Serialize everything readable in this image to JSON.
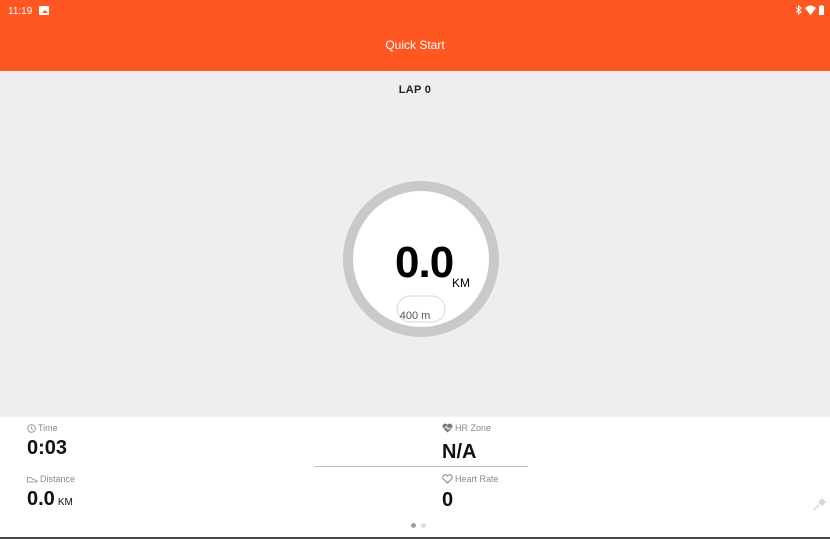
{
  "status_bar": {
    "time": "11:19",
    "icons": [
      "image-icon",
      "bluetooth-icon",
      "wifi-icon",
      "battery-icon"
    ]
  },
  "app_bar": {
    "title": "Quick Start"
  },
  "colors": {
    "accent": "#ff5722",
    "background": "#eeeeee",
    "ring": "#c9c9c9",
    "ring_inner": "#ffffff"
  },
  "workout": {
    "lap_label": "LAP 0",
    "distance_value": "0.0",
    "distance_unit": "KM",
    "lap_length": "400 m"
  },
  "stats": {
    "time": {
      "label": "Time",
      "value": "0:03",
      "icon": "clock-icon"
    },
    "distance": {
      "label": "Distance",
      "value": "0.0",
      "unit": "KM",
      "icon": "shoe-icon"
    },
    "hr_zone": {
      "label": "HR Zone",
      "value": "N/A",
      "icon": "heart-pulse-icon"
    },
    "heart_rate": {
      "label": "Heart Rate",
      "value": "0",
      "icon": "heart-outline-icon"
    }
  },
  "pager": {
    "count": 2,
    "active": 0
  }
}
